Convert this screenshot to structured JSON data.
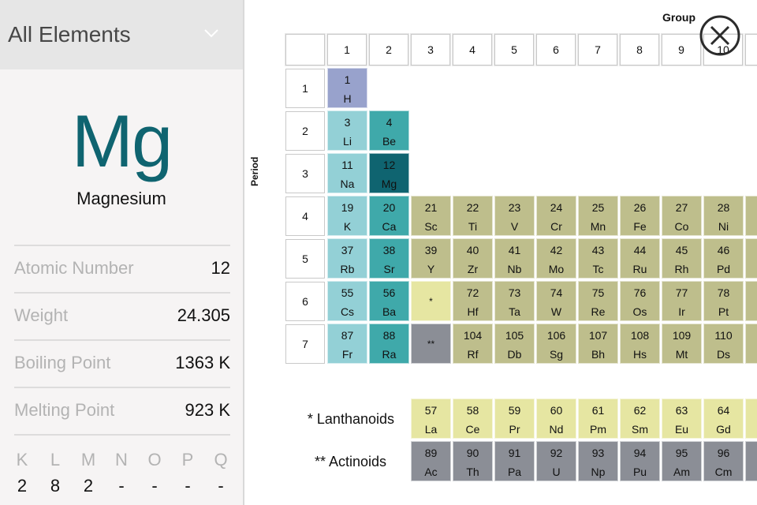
{
  "sidebar": {
    "dropdown": {
      "label": "All Elements",
      "icon": "chevron-down-icon"
    },
    "selected": {
      "symbol": "Mg",
      "name": "Magnesium",
      "color": "#0f6470"
    },
    "properties": [
      {
        "label": "Atomic Number",
        "value": "12"
      },
      {
        "label": "Weight",
        "value": "24.305"
      },
      {
        "label": "Boiling Point",
        "value": "1363 K"
      },
      {
        "label": "Melting Point",
        "value": "923 K"
      }
    ],
    "shells": [
      {
        "label": "K",
        "value": "2"
      },
      {
        "label": "L",
        "value": "8"
      },
      {
        "label": "M",
        "value": "2"
      },
      {
        "label": "N",
        "value": "-"
      },
      {
        "label": "O",
        "value": "-"
      },
      {
        "label": "P",
        "value": "-"
      },
      {
        "label": "Q",
        "value": "-"
      }
    ]
  },
  "table": {
    "group_label": "Group",
    "period_label": "Period",
    "groups": [
      "1",
      "2",
      "3",
      "4",
      "5",
      "6",
      "7",
      "8",
      "9",
      "10"
    ],
    "periods": [
      "1",
      "2",
      "3",
      "4",
      "5",
      "6",
      "7"
    ],
    "colors": {
      "nonmetal": "#98a2cc",
      "alkali": "#93d0d6",
      "alkaline": "#3fa9aa",
      "selected": "#0f6470",
      "transition": "#bebe8c",
      "lanthanoid": "#e6e6a2",
      "actinoid": "#8b8e96"
    },
    "elements": [
      {
        "n": "1",
        "s": "H",
        "row": 1,
        "col": 1,
        "cat": "nonmetal"
      },
      {
        "n": "3",
        "s": "Li",
        "row": 2,
        "col": 1,
        "cat": "alkali"
      },
      {
        "n": "4",
        "s": "Be",
        "row": 2,
        "col": 2,
        "cat": "alkaline"
      },
      {
        "n": "11",
        "s": "Na",
        "row": 3,
        "col": 1,
        "cat": "alkali"
      },
      {
        "n": "12",
        "s": "Mg",
        "row": 3,
        "col": 2,
        "cat": "selected"
      },
      {
        "n": "19",
        "s": "K",
        "row": 4,
        "col": 1,
        "cat": "alkali"
      },
      {
        "n": "20",
        "s": "Ca",
        "row": 4,
        "col": 2,
        "cat": "alkaline"
      },
      {
        "n": "21",
        "s": "Sc",
        "row": 4,
        "col": 3,
        "cat": "transition"
      },
      {
        "n": "22",
        "s": "Ti",
        "row": 4,
        "col": 4,
        "cat": "transition"
      },
      {
        "n": "23",
        "s": "V",
        "row": 4,
        "col": 5,
        "cat": "transition"
      },
      {
        "n": "24",
        "s": "Cr",
        "row": 4,
        "col": 6,
        "cat": "transition"
      },
      {
        "n": "25",
        "s": "Mn",
        "row": 4,
        "col": 7,
        "cat": "transition"
      },
      {
        "n": "26",
        "s": "Fe",
        "row": 4,
        "col": 8,
        "cat": "transition"
      },
      {
        "n": "27",
        "s": "Co",
        "row": 4,
        "col": 9,
        "cat": "transition"
      },
      {
        "n": "28",
        "s": "Ni",
        "row": 4,
        "col": 10,
        "cat": "transition"
      },
      {
        "n": "",
        "s": "",
        "row": 4,
        "col": 11,
        "cat": "transition"
      },
      {
        "n": "37",
        "s": "Rb",
        "row": 5,
        "col": 1,
        "cat": "alkali"
      },
      {
        "n": "38",
        "s": "Sr",
        "row": 5,
        "col": 2,
        "cat": "alkaline"
      },
      {
        "n": "39",
        "s": "Y",
        "row": 5,
        "col": 3,
        "cat": "transition"
      },
      {
        "n": "40",
        "s": "Zr",
        "row": 5,
        "col": 4,
        "cat": "transition"
      },
      {
        "n": "41",
        "s": "Nb",
        "row": 5,
        "col": 5,
        "cat": "transition"
      },
      {
        "n": "42",
        "s": "Mo",
        "row": 5,
        "col": 6,
        "cat": "transition"
      },
      {
        "n": "43",
        "s": "Tc",
        "row": 5,
        "col": 7,
        "cat": "transition"
      },
      {
        "n": "44",
        "s": "Ru",
        "row": 5,
        "col": 8,
        "cat": "transition"
      },
      {
        "n": "45",
        "s": "Rh",
        "row": 5,
        "col": 9,
        "cat": "transition"
      },
      {
        "n": "46",
        "s": "Pd",
        "row": 5,
        "col": 10,
        "cat": "transition"
      },
      {
        "n": "",
        "s": "",
        "row": 5,
        "col": 11,
        "cat": "transition"
      },
      {
        "n": "55",
        "s": "Cs",
        "row": 6,
        "col": 1,
        "cat": "alkali"
      },
      {
        "n": "56",
        "s": "Ba",
        "row": 6,
        "col": 2,
        "cat": "alkaline"
      },
      {
        "n": "",
        "s": "",
        "mark": "*",
        "row": 6,
        "col": 3,
        "cat": "lanthanoid"
      },
      {
        "n": "72",
        "s": "Hf",
        "row": 6,
        "col": 4,
        "cat": "transition"
      },
      {
        "n": "73",
        "s": "Ta",
        "row": 6,
        "col": 5,
        "cat": "transition"
      },
      {
        "n": "74",
        "s": "W",
        "row": 6,
        "col": 6,
        "cat": "transition"
      },
      {
        "n": "75",
        "s": "Re",
        "row": 6,
        "col": 7,
        "cat": "transition"
      },
      {
        "n": "76",
        "s": "Os",
        "row": 6,
        "col": 8,
        "cat": "transition"
      },
      {
        "n": "77",
        "s": "Ir",
        "row": 6,
        "col": 9,
        "cat": "transition"
      },
      {
        "n": "78",
        "s": "Pt",
        "row": 6,
        "col": 10,
        "cat": "transition"
      },
      {
        "n": "",
        "s": "",
        "row": 6,
        "col": 11,
        "cat": "transition"
      },
      {
        "n": "87",
        "s": "Fr",
        "row": 7,
        "col": 1,
        "cat": "alkali"
      },
      {
        "n": "88",
        "s": "Ra",
        "row": 7,
        "col": 2,
        "cat": "alkaline"
      },
      {
        "n": "",
        "s": "",
        "mark": "**",
        "row": 7,
        "col": 3,
        "cat": "actinoid"
      },
      {
        "n": "104",
        "s": "Rf",
        "row": 7,
        "col": 4,
        "cat": "transition"
      },
      {
        "n": "105",
        "s": "Db",
        "row": 7,
        "col": 5,
        "cat": "transition"
      },
      {
        "n": "106",
        "s": "Sg",
        "row": 7,
        "col": 6,
        "cat": "transition"
      },
      {
        "n": "107",
        "s": "Bh",
        "row": 7,
        "col": 7,
        "cat": "transition"
      },
      {
        "n": "108",
        "s": "Hs",
        "row": 7,
        "col": 8,
        "cat": "transition"
      },
      {
        "n": "109",
        "s": "Mt",
        "row": 7,
        "col": 9,
        "cat": "transition"
      },
      {
        "n": "110",
        "s": "Ds",
        "row": 7,
        "col": 10,
        "cat": "transition"
      },
      {
        "n": "",
        "s": "",
        "row": 7,
        "col": 11,
        "cat": "transition"
      }
    ],
    "lanthanoids": {
      "label": "* Lanthanoids",
      "items": [
        {
          "n": "57",
          "s": "La"
        },
        {
          "n": "58",
          "s": "Ce"
        },
        {
          "n": "59",
          "s": "Pr"
        },
        {
          "n": "60",
          "s": "Nd"
        },
        {
          "n": "61",
          "s": "Pm"
        },
        {
          "n": "62",
          "s": "Sm"
        },
        {
          "n": "63",
          "s": "Eu"
        },
        {
          "n": "64",
          "s": "Gd"
        },
        {
          "n": "",
          "s": ""
        }
      ]
    },
    "actinoids": {
      "label": "** Actinoids",
      "items": [
        {
          "n": "89",
          "s": "Ac"
        },
        {
          "n": "90",
          "s": "Th"
        },
        {
          "n": "91",
          "s": "Pa"
        },
        {
          "n": "92",
          "s": "U"
        },
        {
          "n": "93",
          "s": "Np"
        },
        {
          "n": "94",
          "s": "Pu"
        },
        {
          "n": "95",
          "s": "Am"
        },
        {
          "n": "96",
          "s": "Cm"
        },
        {
          "n": "",
          "s": ""
        }
      ]
    }
  },
  "close_button": {
    "icon": "close-icon"
  }
}
